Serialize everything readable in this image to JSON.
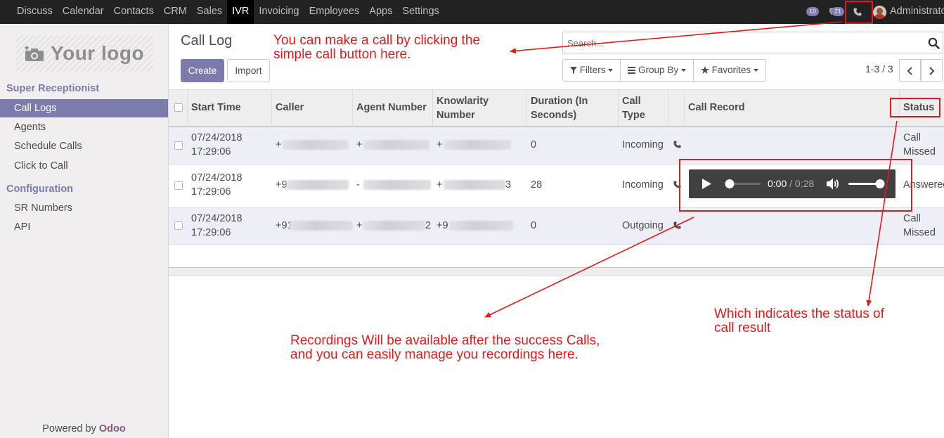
{
  "topbar": {
    "menu": [
      "Discuss",
      "Calendar",
      "Contacts",
      "CRM",
      "Sales",
      "IVR",
      "Invoicing",
      "Employees",
      "Apps",
      "Settings"
    ],
    "active_menu": "IVR",
    "activity_badge": "10",
    "messages_badge": "21",
    "user": "Administrator"
  },
  "sidebar": {
    "logo_text": "Your logo",
    "section1": "Super Receptionist",
    "items1": [
      "Call Logs",
      "Agents",
      "Schedule Calls",
      "Click to Call"
    ],
    "section2": "Configuration",
    "items2": [
      "SR Numbers",
      "API"
    ],
    "powered_by": "Powered by",
    "brand": "Odoo"
  },
  "control": {
    "title": "Call Log",
    "create": "Create",
    "import": "Import",
    "search_placeholder": "Search...",
    "filters": "Filters",
    "group_by": "Group By",
    "favorites": "Favorites",
    "pager": "1-3 / 3"
  },
  "table": {
    "headers": {
      "start_time": "Start Time",
      "caller": "Caller",
      "agent_number": "Agent Number",
      "knowlarity_1": "Knowlarity",
      "knowlarity_2": "Number",
      "duration_1": "Duration (In",
      "duration_2": "Seconds)",
      "call_type_1": "Call",
      "call_type_2": "Type",
      "call_record": "Call Record",
      "status": "Status"
    },
    "rows": [
      {
        "date": "07/24/2018",
        "time": "17:29:06",
        "caller": "+",
        "agent": "+",
        "knowlarity": "+",
        "duration": "0",
        "type": "Incoming",
        "status1": "Call",
        "status2": "Missed"
      },
      {
        "date": "07/24/2018",
        "time": "17:29:06",
        "caller": "+9",
        "agent": "-",
        "knowlarity": "+",
        "knowlarity_tail": "3",
        "duration": "28",
        "type": "Incoming",
        "status1": "Answered",
        "status2": ""
      },
      {
        "date": "07/24/2018",
        "time": "17:29:06",
        "caller": "+91",
        "agent": "+",
        "agent_tail": "2",
        "knowlarity": "+9",
        "duration": "0",
        "type": "Outgoing",
        "status1": "Call",
        "status2": "Missed"
      }
    ]
  },
  "player": {
    "current": "0:00",
    "separator": "/",
    "total": "0:28",
    "progress_fraction": 0,
    "volume_fraction": 1
  },
  "annotations": {
    "call_button_1": "You can make a call by clicking the",
    "call_button_2": "simple call button here.",
    "recordings_1": "Recordings Will be available after the success Calls,",
    "recordings_2": "and you can easily manage you recordings here.",
    "status_1": "Which indicates the status of",
    "status_2": "call result"
  },
  "colors": {
    "brand": "#7c7bad",
    "annotation": "#e41a1a",
    "odoo": "#875a7b"
  }
}
